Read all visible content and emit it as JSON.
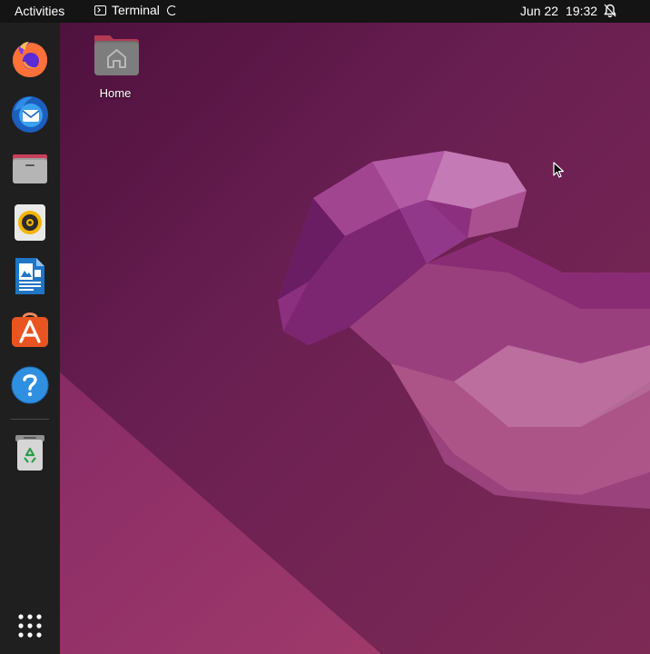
{
  "topbar": {
    "activities_label": "Activities",
    "app_name": "Terminal",
    "date": "Jun 22",
    "time": "19:32"
  },
  "desktop": {
    "home_icon_label": "Home"
  },
  "dock": {
    "items": [
      {
        "name": "Firefox",
        "icon": "firefox-icon"
      },
      {
        "name": "Thunderbird",
        "icon": "thunderbird-icon"
      },
      {
        "name": "Files",
        "icon": "files-icon"
      },
      {
        "name": "Rhythmbox",
        "icon": "rhythmbox-icon"
      },
      {
        "name": "LibreOffice Writer",
        "icon": "writer-icon"
      },
      {
        "name": "Ubuntu Software",
        "icon": "software-icon"
      },
      {
        "name": "Help",
        "icon": "help-icon"
      },
      {
        "name": "Trash",
        "icon": "trash-icon"
      },
      {
        "name": "Show Applications",
        "icon": "app-grid-icon"
      }
    ]
  },
  "colors": {
    "topbar": "#141414",
    "dock": "#1f1f1f",
    "wallpaper_dark": "#3d0f33",
    "wallpaper_mid": "#7a2a5f",
    "accent": "#e95420"
  }
}
